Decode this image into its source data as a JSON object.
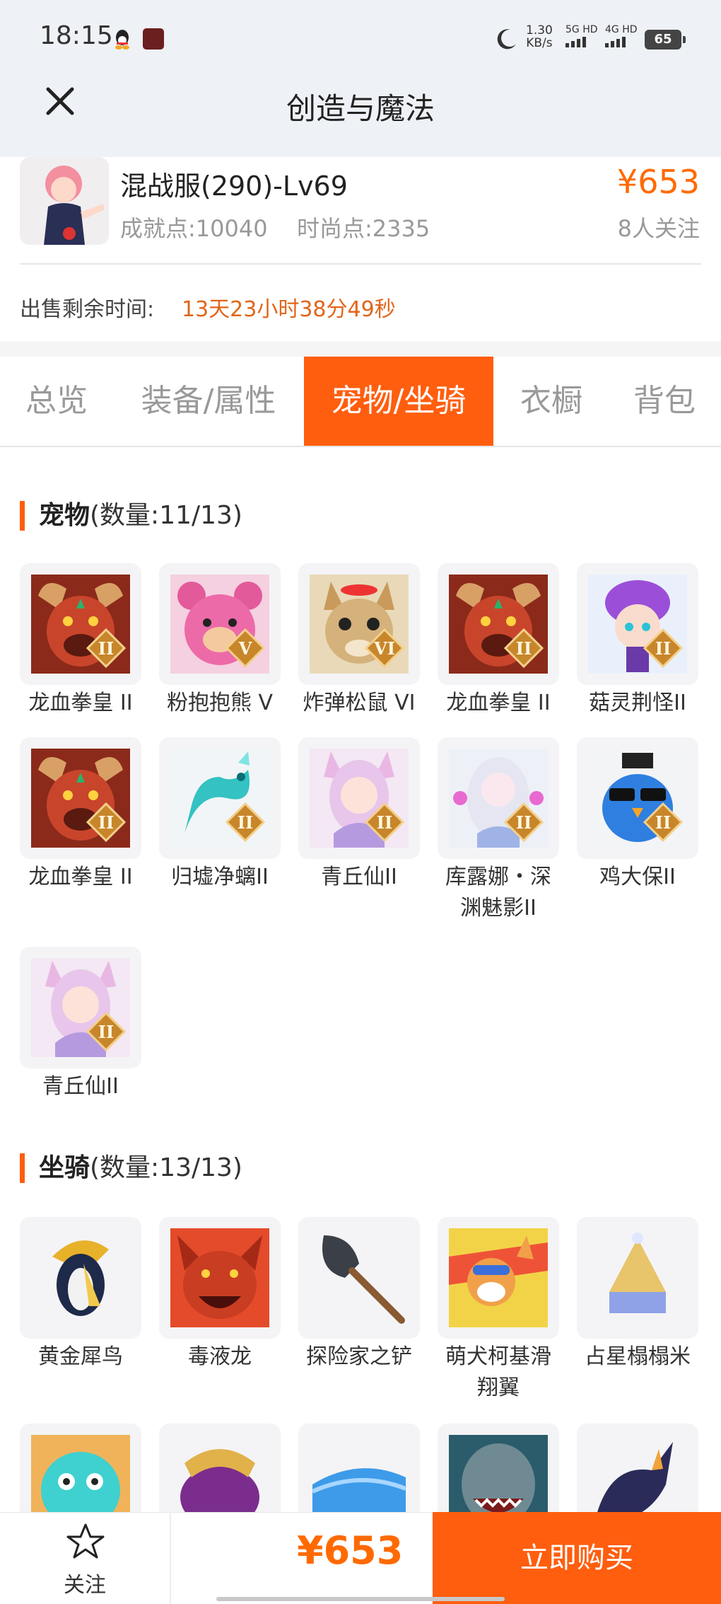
{
  "status": {
    "time": "18:15",
    "speed_value": "1.30",
    "speed_unit": "KB/s",
    "net1": "5G HD",
    "net2": "4G HD",
    "battery": "65"
  },
  "nav": {
    "title": "创造与魔法"
  },
  "item": {
    "name": "混战服(290)-Lv69",
    "achievement": "成就点:10040",
    "fashion": "时尚点:2335",
    "price": "¥653",
    "followers": "8人关注",
    "remain_label": "出售剩余时间:",
    "remain_value": "13天23小时38分49秒"
  },
  "tabs": [
    {
      "label": "总览"
    },
    {
      "label": "装备/属性"
    },
    {
      "label": "宠物/坐骑"
    },
    {
      "label": "衣橱"
    },
    {
      "label": "背包"
    }
  ],
  "active_tab": "宠物/坐骑",
  "pets": {
    "title": "宠物",
    "count": "(数量:11/13)",
    "items": [
      {
        "label": "龙血拳皇 II",
        "badge": "II",
        "icon": "dragon-boxer"
      },
      {
        "label": "粉抱抱熊 V",
        "badge": "V",
        "icon": "pink-bear"
      },
      {
        "label": "炸弹松鼠 VI",
        "badge": "VI",
        "icon": "bomb-squirrel"
      },
      {
        "label": "龙血拳皇 II",
        "badge": "II",
        "icon": "dragon-boxer"
      },
      {
        "label": "菇灵荆怪II",
        "badge": "II",
        "icon": "mushroom-sprite"
      },
      {
        "label": "龙血拳皇 II",
        "badge": "II",
        "icon": "dragon-boxer"
      },
      {
        "label": "归墟净螭II",
        "badge": "II",
        "icon": "cyan-dragon"
      },
      {
        "label": "青丘仙II",
        "badge": "II",
        "icon": "fox-fairy"
      },
      {
        "label": "库露娜・深渊魅影II",
        "badge": "II",
        "icon": "white-spirit"
      },
      {
        "label": "鸡大保II",
        "badge": "II",
        "icon": "blue-chicken"
      },
      {
        "label": "青丘仙II",
        "badge": "II",
        "icon": "fox-fairy"
      }
    ]
  },
  "mounts": {
    "title": "坐骑",
    "count": "(数量:13/13)",
    "items": [
      {
        "label": "黄金犀鸟",
        "icon": "golden-hornbill"
      },
      {
        "label": "毒液龙",
        "icon": "venom-dragon"
      },
      {
        "label": "探险家之铲",
        "icon": "explorer-shovel"
      },
      {
        "label": "萌犬柯基滑翔翼",
        "icon": "corgi-glider"
      },
      {
        "label": "占星榻榻米",
        "icon": "astrology-tatami"
      },
      {
        "label": "",
        "icon": "cyan-creature"
      },
      {
        "label": "",
        "icon": "purple-mount"
      },
      {
        "label": "",
        "icon": "blue-whale"
      },
      {
        "label": "",
        "icon": "shark-mount"
      },
      {
        "label": "",
        "icon": "dark-dragon"
      }
    ]
  },
  "bottom": {
    "follow_label": "关注",
    "price": "¥653",
    "buy_label": "立即购买"
  },
  "colors": {
    "accent": "#ff5e0e",
    "price": "#ff6a00"
  }
}
